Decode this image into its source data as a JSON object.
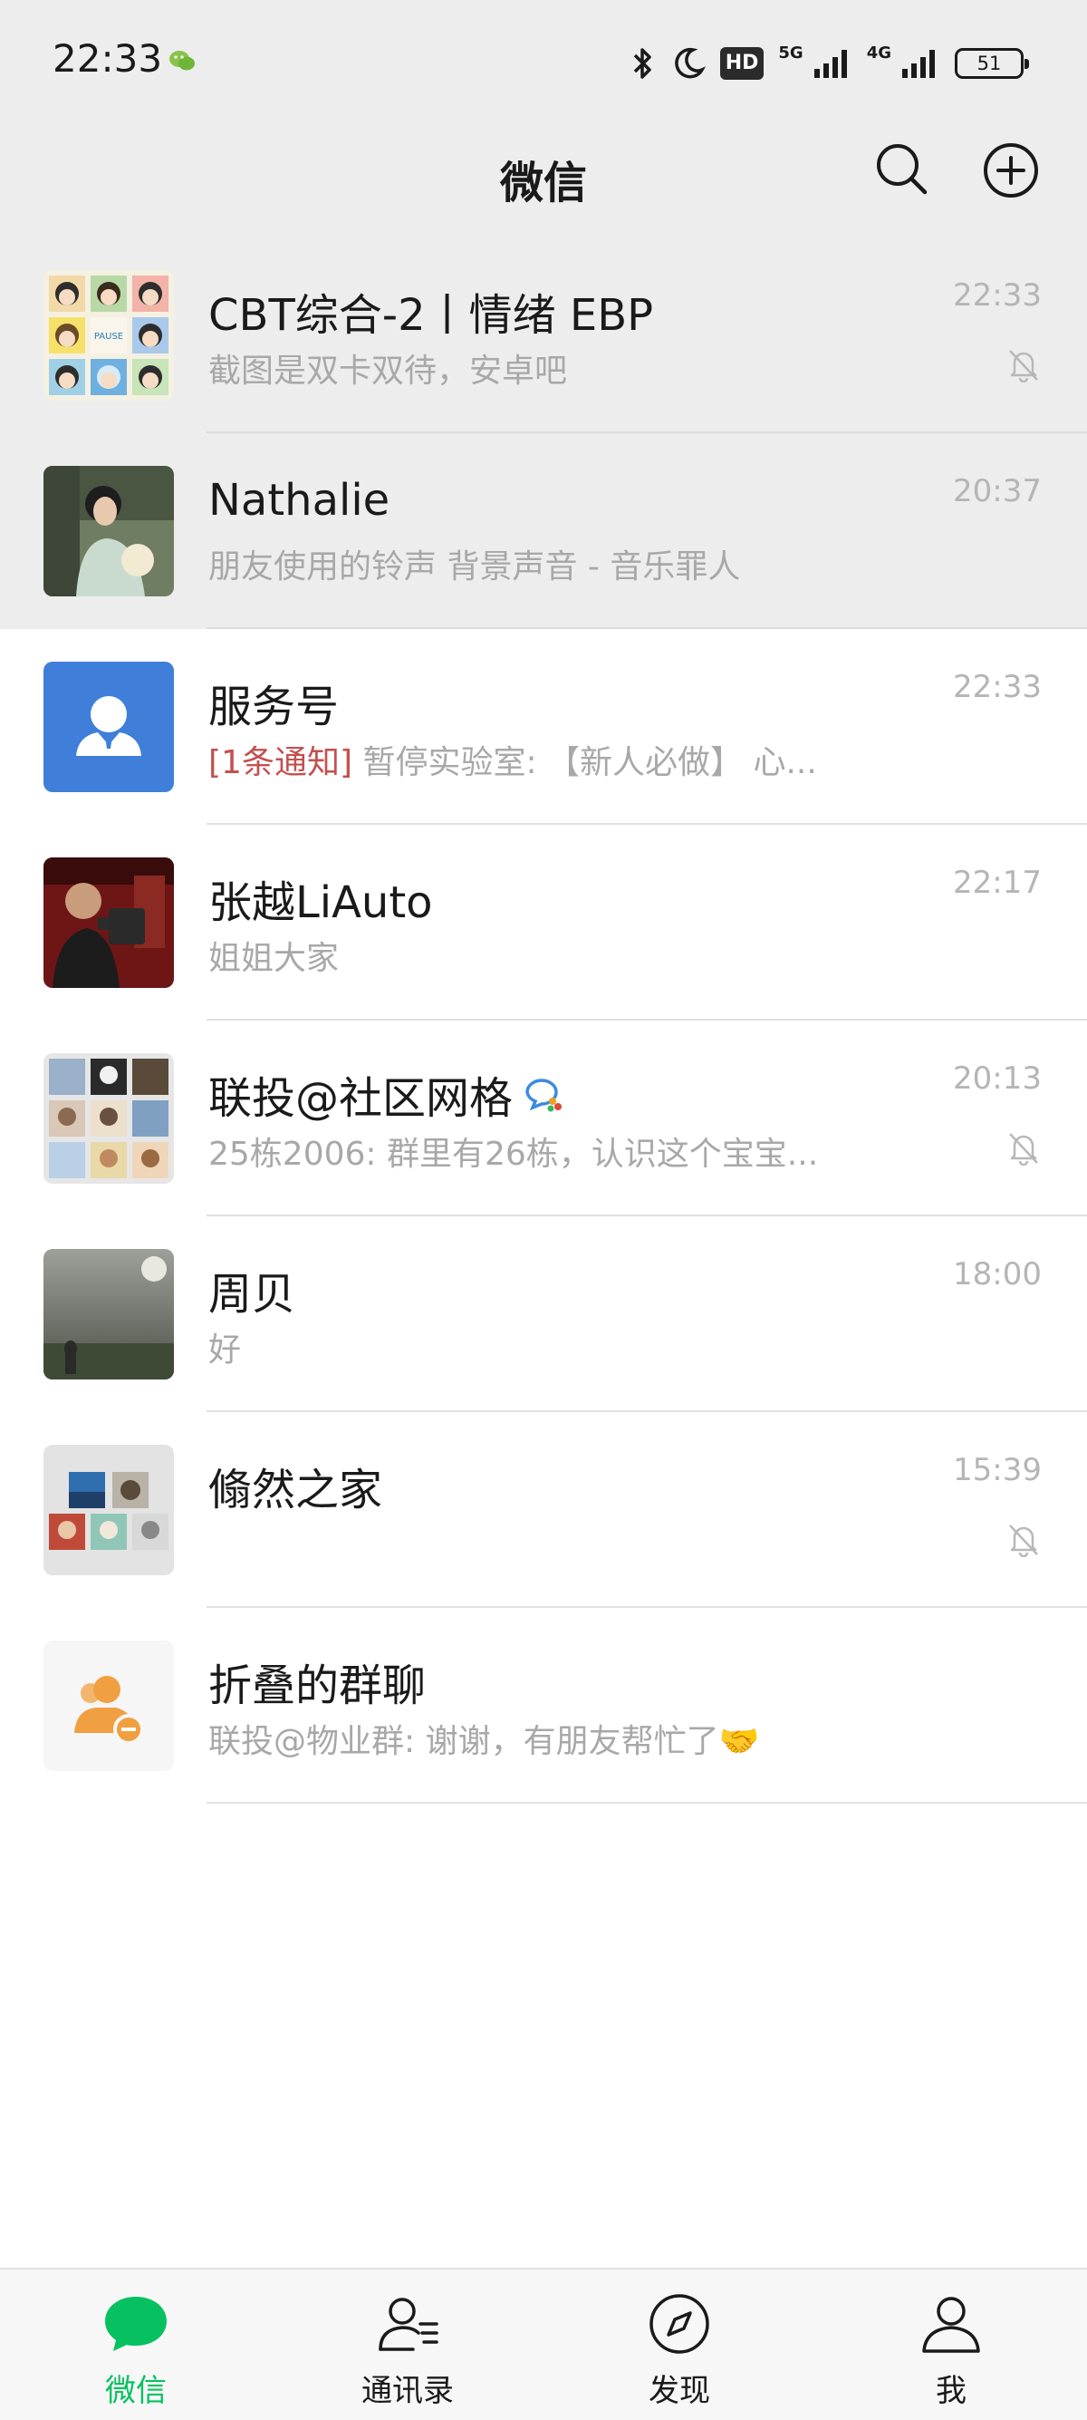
{
  "status_bar": {
    "time": "22:33",
    "hd_label": "HD",
    "net1": "5G",
    "net2": "4G",
    "battery": "51"
  },
  "nav": {
    "title": "微信",
    "search_icon": "search-icon",
    "add_icon": "plus-circle-icon"
  },
  "chats": [
    {
      "name": "CBT综合-2丨情绪 EBP",
      "preview": "截图是双卡双待，安卓吧",
      "time": "22:33",
      "muted": true,
      "pinned": true
    },
    {
      "name": "Nathalie",
      "preview": "朋友使用的铃声 背景声音 - 音乐罪人",
      "time": "20:37",
      "muted": false,
      "pinned": true
    },
    {
      "name": "服务号",
      "tag": "[1条通知]",
      "preview": " 暂停实验室: 【新人必做】 心...",
      "time": "22:33",
      "muted": false,
      "pinned": false
    },
    {
      "name": "张越LiAuto",
      "preview": "姐姐大家",
      "time": "22:17",
      "muted": false,
      "pinned": false
    },
    {
      "name": "联投@社区网格",
      "preview": "25栋2006: 群里有26栋，认识这个宝宝...",
      "time": "20:13",
      "muted": true,
      "pinned": false
    },
    {
      "name": "周贝",
      "preview": "好",
      "time": "18:00",
      "muted": false,
      "pinned": false
    },
    {
      "name": "翛然之家",
      "preview": "",
      "time": "15:39",
      "muted": true,
      "pinned": false
    },
    {
      "name": "折叠的群聊",
      "preview": "联投@物业群: 谢谢，有朋友帮忙了🤝",
      "time": "",
      "muted": false,
      "pinned": false
    }
  ],
  "tabs": [
    {
      "label": "微信",
      "icon": "chat-bubble-icon",
      "active": true
    },
    {
      "label": "通讯录",
      "icon": "contacts-icon",
      "active": false
    },
    {
      "label": "发现",
      "icon": "compass-icon",
      "active": false
    },
    {
      "label": "我",
      "icon": "person-icon",
      "active": false
    }
  ],
  "colors": {
    "accent": "#07c160",
    "header_bg": "#ededed",
    "notice": "#c35050",
    "service_blue": "#3f7fd9",
    "folded_orange": "#f0a040"
  }
}
